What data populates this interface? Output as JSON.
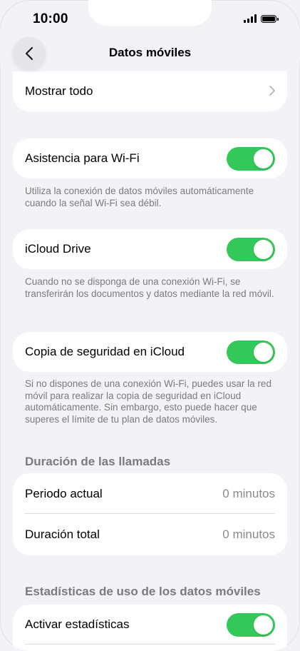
{
  "status_bar": {
    "time": "10:00"
  },
  "nav": {
    "title": "Datos móviles"
  },
  "show_all": {
    "label": "Mostrar todo"
  },
  "wifi_assist": {
    "label": "Asistencia para Wi-Fi",
    "enabled": true,
    "footer": "Utiliza la conexión de datos móviles automáticamente cuando la señal Wi-Fi sea débil."
  },
  "icloud_drive": {
    "label": "iCloud Drive",
    "enabled": true,
    "footer": "Cuando no se disponga de una conexión Wi-Fi, se transferirán los documentos y datos mediante la red móvil."
  },
  "icloud_backup": {
    "label": "Copia de seguridad en iCloud",
    "enabled": true,
    "footer": "Si no dispones de una conexión Wi-Fi, puedes usar la red móvil para realizar la copia de seguridad en iCloud automáticamente. Sin embargo, esto puede hacer que superes el límite de tu plan de datos móviles."
  },
  "call_duration": {
    "header": "Duración de las llamadas",
    "rows": [
      {
        "label": "Periodo actual",
        "value": "0 minutos"
      },
      {
        "label": "Duración total",
        "value": "0 minutos"
      }
    ]
  },
  "usage_stats": {
    "header": "Estadísticas de uso de los datos móviles",
    "toggle_label": "Activar estadísticas",
    "enabled": true
  },
  "colors": {
    "toggle_on": "#34c759",
    "background": "#f2f2f7"
  }
}
